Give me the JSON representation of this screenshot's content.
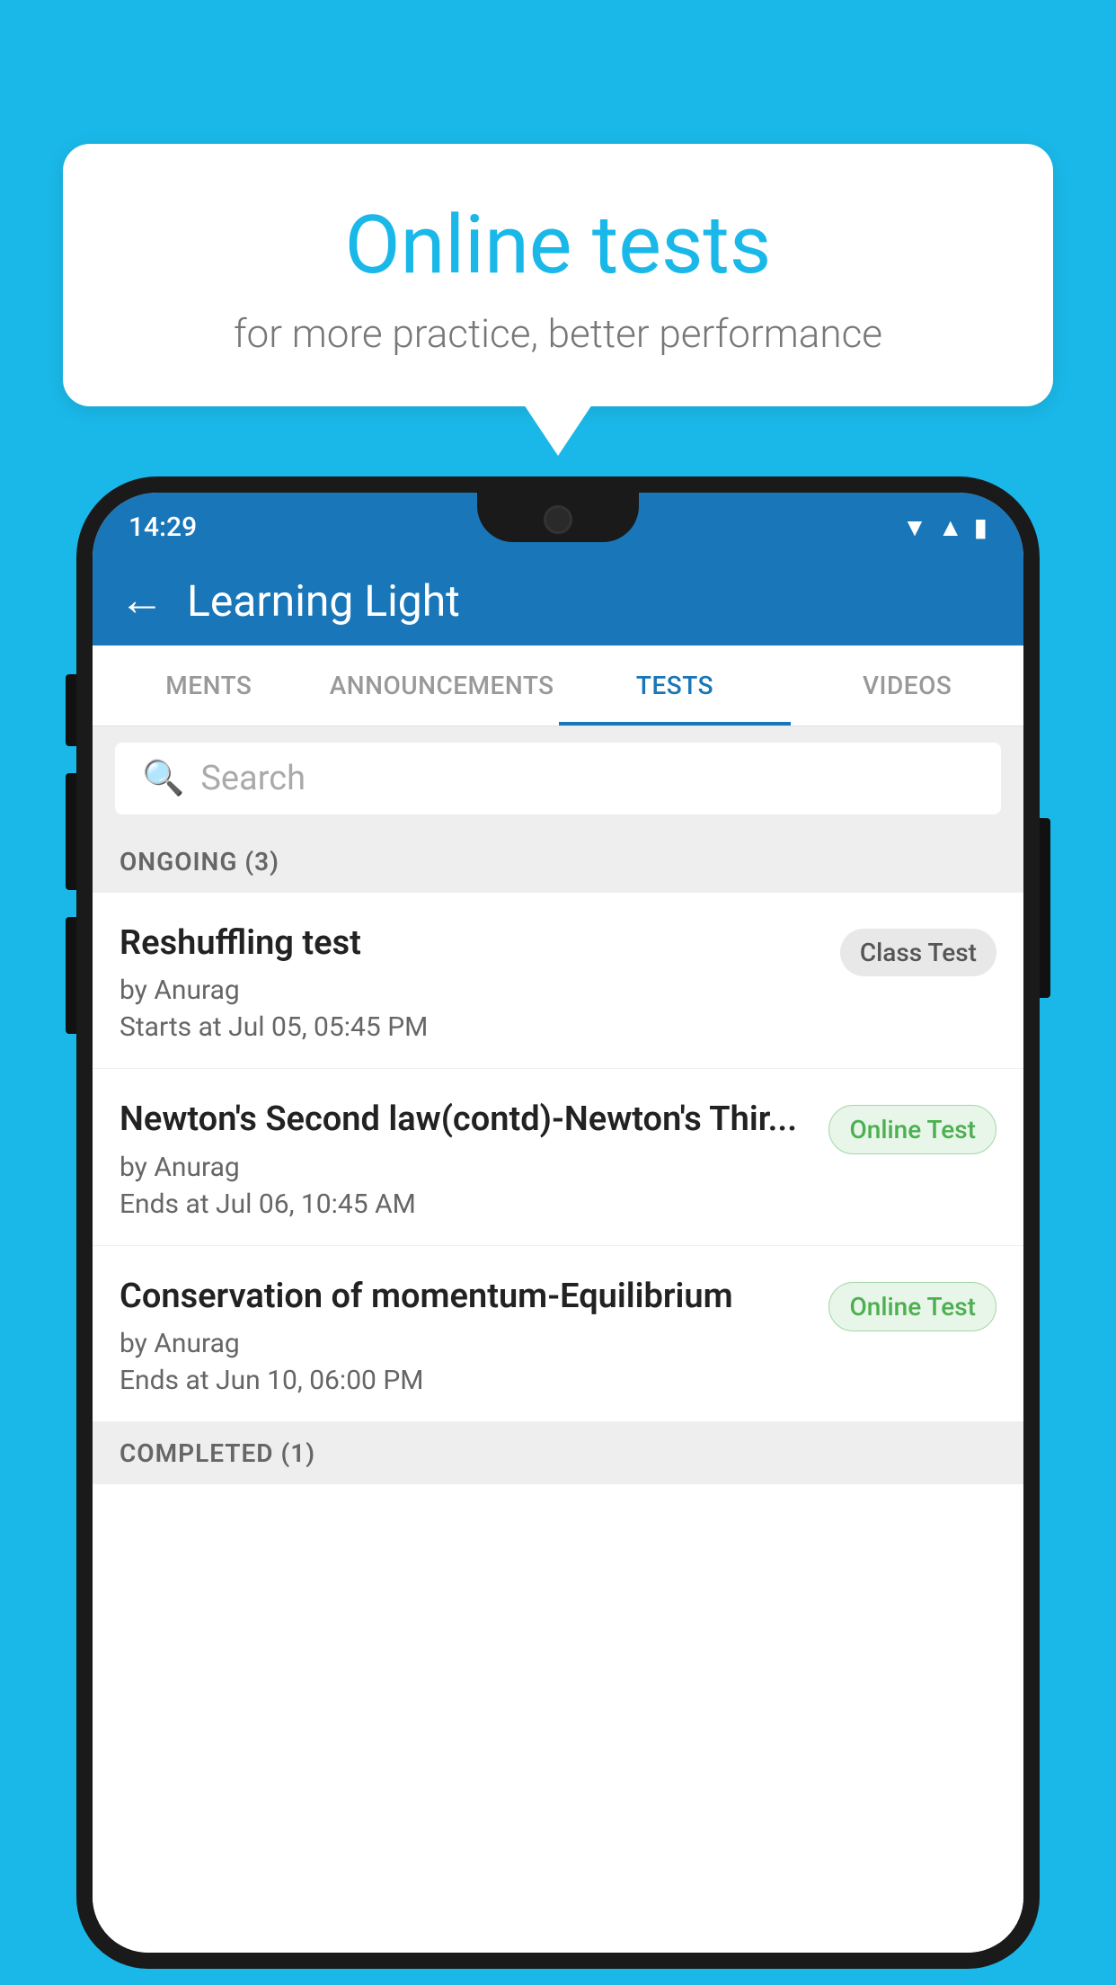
{
  "background_color": "#1ab8e8",
  "speech_bubble": {
    "title": "Online tests",
    "subtitle": "for more practice, better performance"
  },
  "phone": {
    "status_bar": {
      "time": "14:29",
      "wifi": "▾",
      "signal": "▲",
      "battery": "▮"
    },
    "app_bar": {
      "back_label": "←",
      "title": "Learning Light"
    },
    "tabs": [
      {
        "label": "MENTS",
        "active": false
      },
      {
        "label": "ANNOUNCEMENTS",
        "active": false
      },
      {
        "label": "TESTS",
        "active": true
      },
      {
        "label": "VIDEOS",
        "active": false
      }
    ],
    "search": {
      "placeholder": "Search"
    },
    "sections": [
      {
        "header": "ONGOING (3)",
        "items": [
          {
            "name": "Reshuffling test",
            "author": "by Anurag",
            "date": "Starts at  Jul 05, 05:45 PM",
            "badge": "Class Test",
            "badge_type": "class"
          },
          {
            "name": "Newton's Second law(contd)-Newton's Thir...",
            "author": "by Anurag",
            "date": "Ends at  Jul 06, 10:45 AM",
            "badge": "Online Test",
            "badge_type": "online"
          },
          {
            "name": "Conservation of momentum-Equilibrium",
            "author": "by Anurag",
            "date": "Ends at  Jun 10, 06:00 PM",
            "badge": "Online Test",
            "badge_type": "online"
          }
        ]
      }
    ],
    "completed_header": "COMPLETED (1)"
  }
}
